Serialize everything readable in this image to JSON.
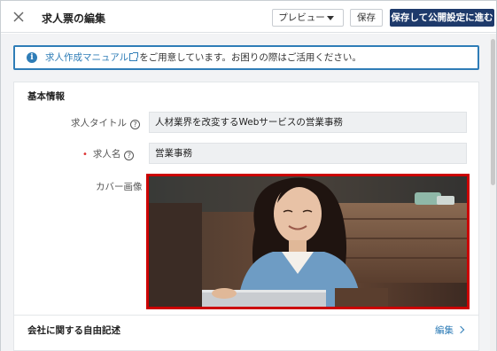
{
  "header": {
    "title": "求人票の編集",
    "preview_label": "プレビュー",
    "save_label": "保存",
    "save_next_label": "保存して公開設定に進む"
  },
  "notice": {
    "link_text": "求人作成マニュアル",
    "message": "をご用意しています。お困りの際はご活用ください。"
  },
  "basic_info": {
    "section_title": "基本情報",
    "job_title_label": "求人タイトル",
    "job_title_value": "人材業界を改変するWebサービスの営業事務",
    "job_name_label": "求人名",
    "job_name_value": "営業事務",
    "required_mark": "•",
    "cover_image_label": "カバー画像"
  },
  "free_text": {
    "label": "会社に関する自由記述",
    "edit_label": "編集"
  },
  "colors": {
    "primary": "#1e3a6b",
    "link": "#2f7db7",
    "highlight_border": "#cc0000"
  }
}
